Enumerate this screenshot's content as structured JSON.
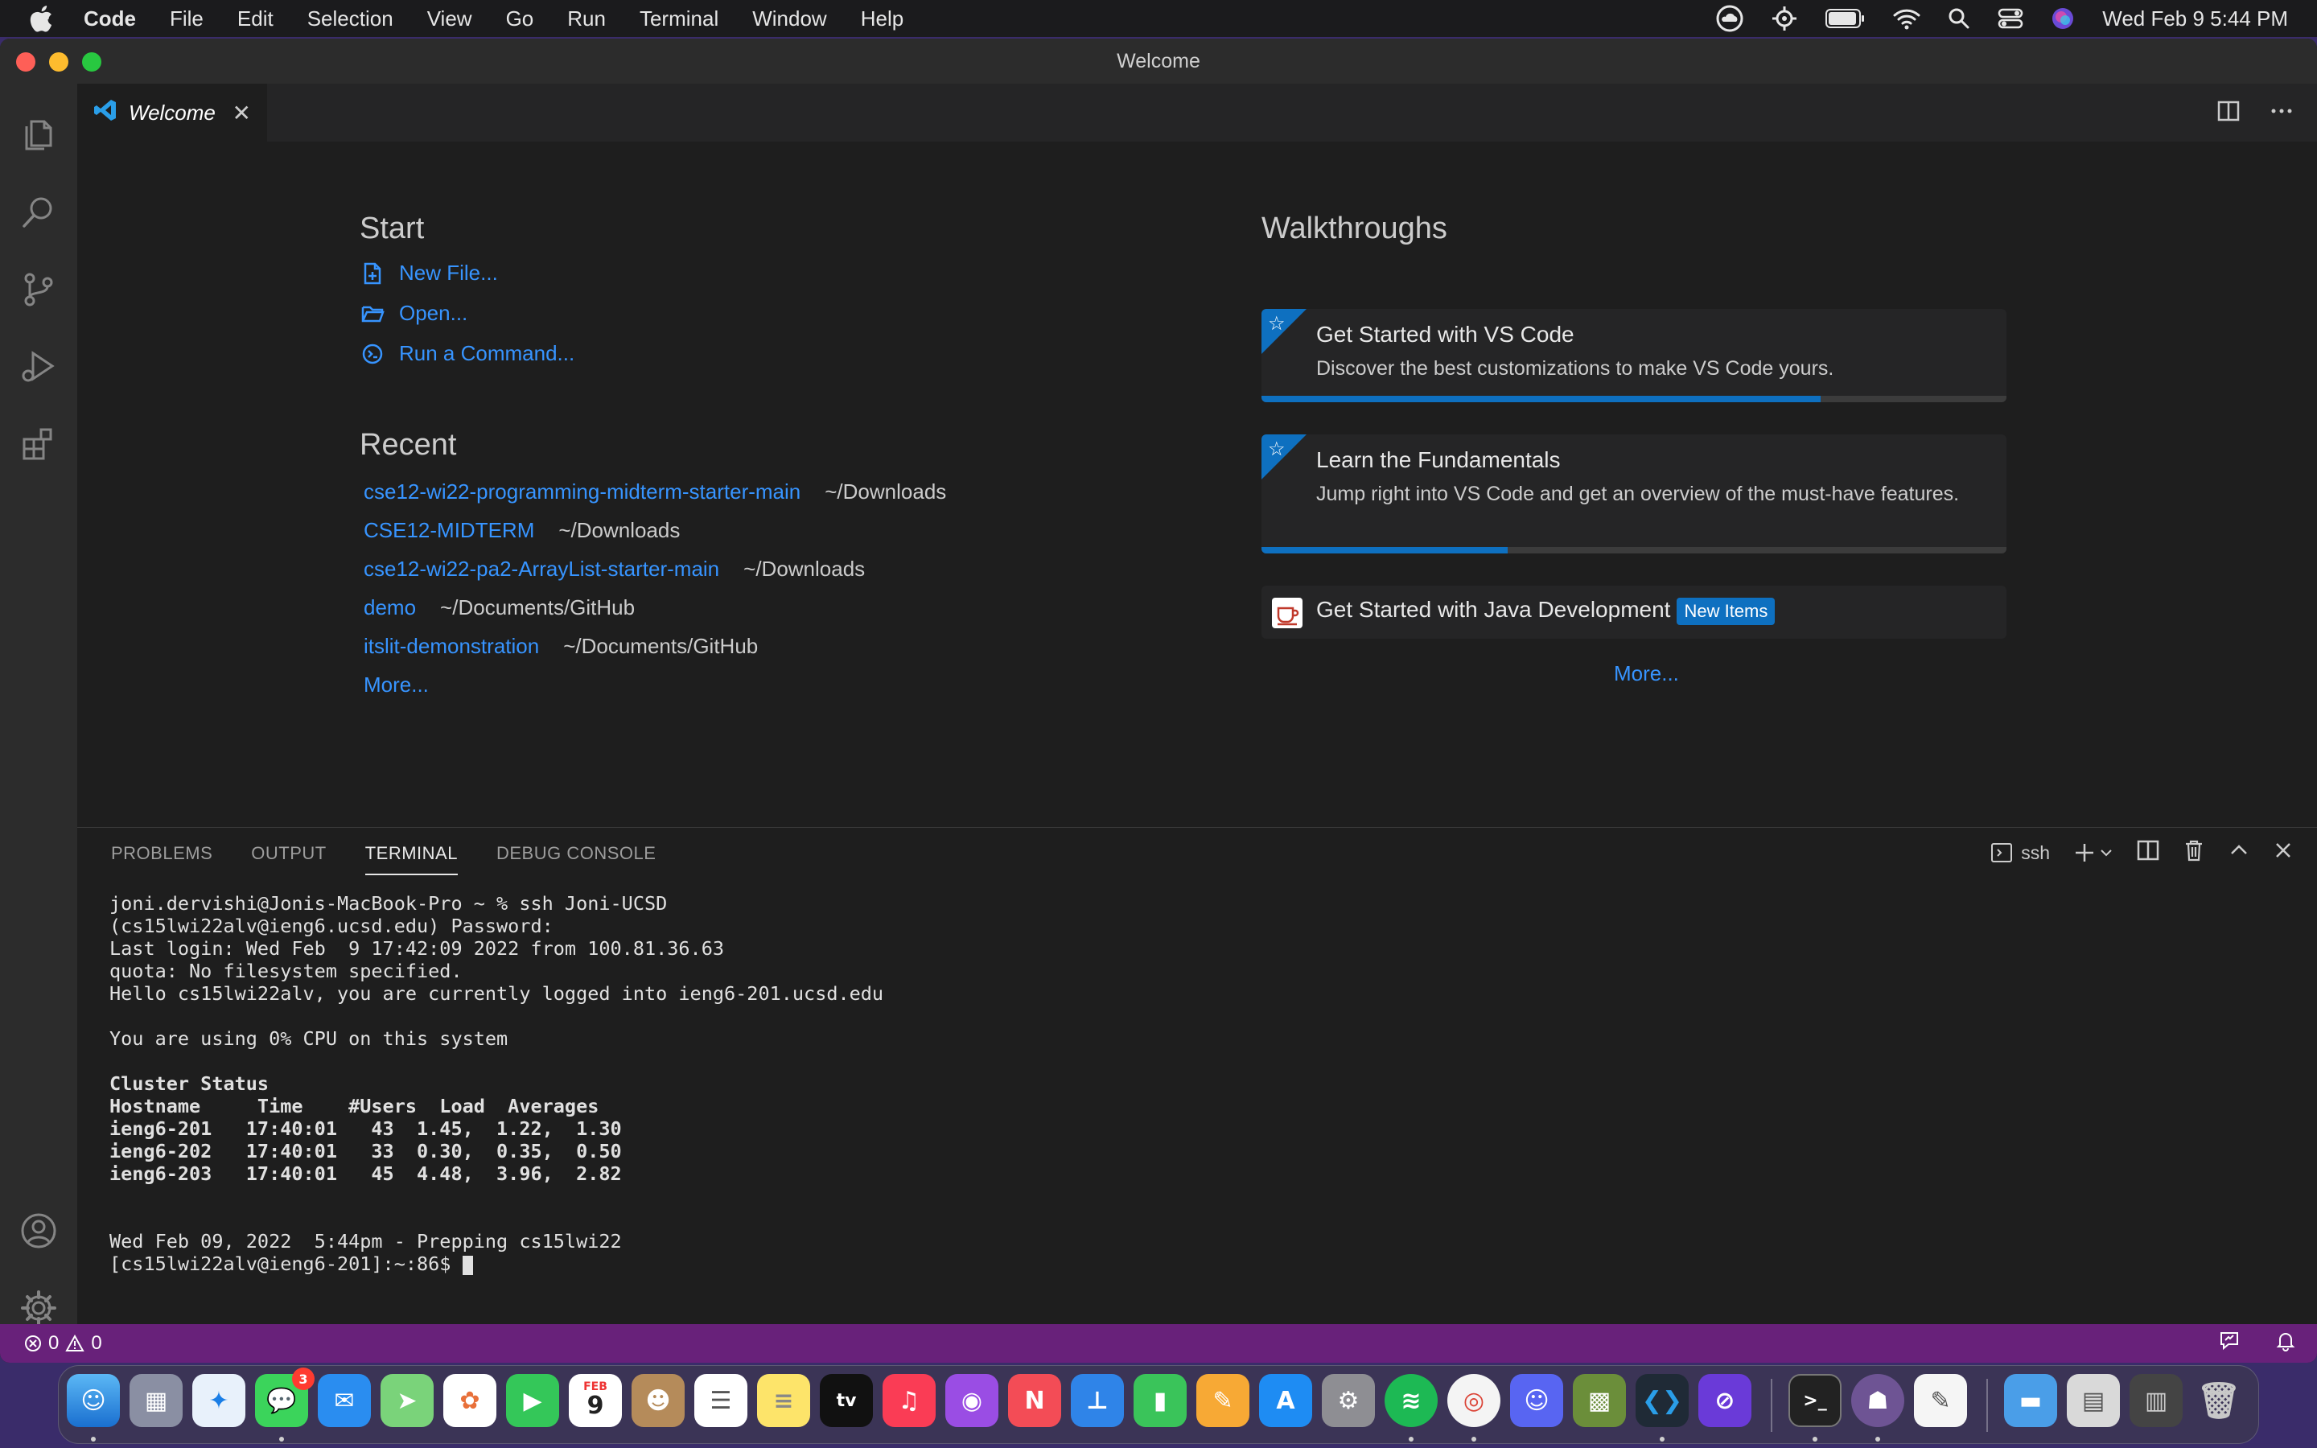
{
  "menubar": {
    "app": "Code",
    "items": [
      "File",
      "Edit",
      "Selection",
      "View",
      "Go",
      "Run",
      "Terminal",
      "Window",
      "Help"
    ],
    "clock": "Wed Feb 9  5:44 PM"
  },
  "window": {
    "title": "Welcome"
  },
  "tab": {
    "label": "Welcome",
    "close": "✕"
  },
  "start": {
    "heading": "Start",
    "new_file": "New File...",
    "open": "Open...",
    "run_command": "Run a Command..."
  },
  "recent": {
    "heading": "Recent",
    "items": [
      {
        "name": "cse12-wi22-programming-midterm-starter-main",
        "path": "~/Downloads"
      },
      {
        "name": "CSE12-MIDTERM",
        "path": "~/Downloads"
      },
      {
        "name": "cse12-wi22-pa2-ArrayList-starter-main",
        "path": "~/Downloads"
      },
      {
        "name": "demo",
        "path": "~/Documents/GitHub"
      },
      {
        "name": "itslit-demonstration",
        "path": "~/Documents/GitHub"
      }
    ],
    "more": "More..."
  },
  "walkthroughs": {
    "heading": "Walkthroughs",
    "cards": [
      {
        "title": "Get Started with VS Code",
        "desc": "Discover the best customizations to make VS Code yours.",
        "progress": 0.75
      },
      {
        "title": "Learn the Fundamentals",
        "desc": "Jump right into VS Code and get an overview of the must-have features.",
        "progress": 0.33
      },
      {
        "title": "Get Started with Java Development",
        "badge": "New Items"
      }
    ],
    "more": "More..."
  },
  "panel": {
    "tabs": [
      "PROBLEMS",
      "OUTPUT",
      "TERMINAL",
      "DEBUG CONSOLE"
    ],
    "active_tab": "TERMINAL",
    "shell": "ssh"
  },
  "terminal": {
    "lines": [
      "joni.dervishi@Jonis-MacBook-Pro ~ % ssh Joni-UCSD",
      "(cs15lwi22alv@ieng6.ucsd.edu) Password:",
      "Last login: Wed Feb  9 17:42:09 2022 from 100.81.36.63",
      "quota: No filesystem specified.",
      "Hello cs15lwi22alv, you are currently logged into ieng6-201.ucsd.edu",
      "",
      "You are using 0% CPU on this system",
      "",
      "Cluster Status",
      "Hostname     Time    #Users  Load  Averages",
      "ieng6-201   17:40:01   43  1.45,  1.22,  1.30",
      "ieng6-202   17:40:01   33  0.30,  0.35,  0.50",
      "ieng6-203   17:40:01   45  4.48,  3.96,  2.82",
      "",
      "",
      "Wed Feb 09, 2022  5:44pm - Prepping cs15lwi22",
      "[cs15lwi22alv@ieng6-201]:~:86$ "
    ]
  },
  "status": {
    "errors": "0",
    "warnings": "0"
  },
  "dock": {
    "messages_badge": "3",
    "calendar_month": "FEB",
    "calendar_day": "9",
    "tv_label": "tv"
  },
  "colors": {
    "accent": "#0e70c0",
    "link": "#3794ff",
    "statusbar": "#68217a"
  }
}
